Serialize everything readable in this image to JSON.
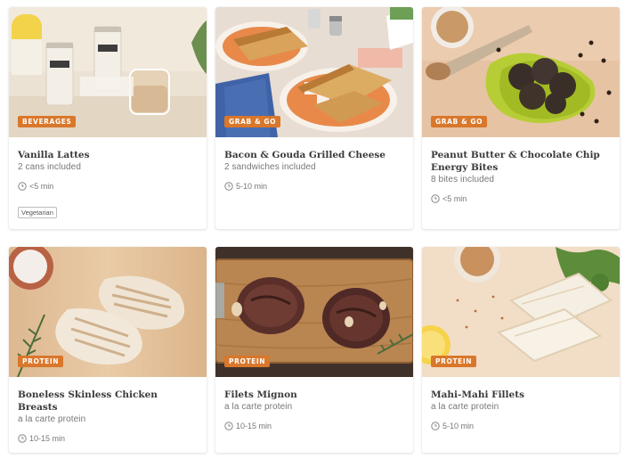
{
  "cards": [
    {
      "tag": "BEVERAGES",
      "title": "Vanilla Lattes",
      "subtitle": "2 cans included",
      "time": "<5 min",
      "badge": "Vegetarian",
      "image": "latte-cans-photo"
    },
    {
      "tag": "GRAB & GO",
      "title": "Bacon & Gouda Grilled Cheese",
      "subtitle": "2 sandwiches included",
      "time": "5-10 min",
      "image": "grilled-cheese-photo"
    },
    {
      "tag": "GRAB & GO",
      "title_line1": "Peanut Butter & Chocolate Chip",
      "title_line2": "Energy Bites",
      "subtitle": "8 bites included",
      "time": "<5 min",
      "image": "energy-bites-photo"
    },
    {
      "tag": "PROTEIN",
      "title": "Boneless Skinless Chicken Breasts",
      "subtitle": "a la carte protein",
      "time": "10-15 min",
      "image": "chicken-breasts-photo"
    },
    {
      "tag": "PROTEIN",
      "title": "Filets Mignon",
      "subtitle": "a la carte protein",
      "time": "10-15 min",
      "image": "filets-mignon-photo"
    },
    {
      "tag": "PROTEIN",
      "title": "Mahi-Mahi Fillets",
      "subtitle": "a la carte protein",
      "time": "5-10 min",
      "image": "mahi-mahi-photo"
    }
  ],
  "colors": {
    "tag_bg": "#d9772b",
    "title": "#3a3a3a",
    "meta": "#777777"
  },
  "icons": {
    "time": "clock-icon"
  }
}
